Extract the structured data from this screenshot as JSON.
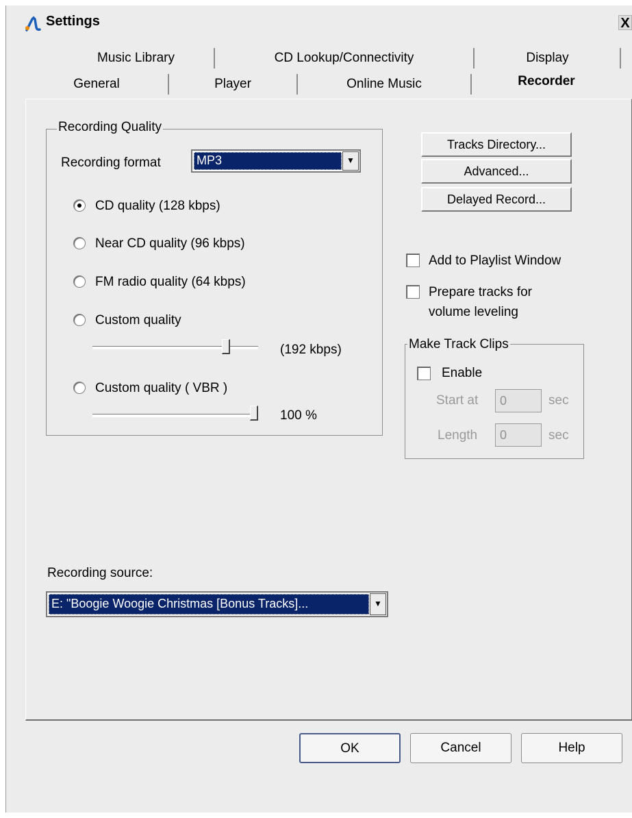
{
  "window": {
    "title": "Settings",
    "close_glyph": "X"
  },
  "tabs": {
    "row1": [
      "Music Library",
      "CD Lookup/Connectivity",
      "Display"
    ],
    "row2": [
      "General",
      "Player",
      "Online Music",
      "Recorder"
    ],
    "active": "Recorder"
  },
  "recording_quality": {
    "group_label": "Recording Quality",
    "format_label": "Recording format",
    "format_value": "MP3",
    "options": [
      "CD quality (128 kbps)",
      "Near CD quality (96 kbps)",
      "FM radio quality (64 kbps)",
      "Custom quality",
      "Custom quality ( VBR )"
    ],
    "selected_option_index": 0,
    "custom_slider_text": "(192 kbps)",
    "custom_slider_level": 0.82,
    "vbr_slider_text": "100 %",
    "vbr_slider_level": 1.0
  },
  "side_buttons": [
    "Tracks Directory...",
    "Advanced...",
    "Delayed Record..."
  ],
  "checkboxes": {
    "add_to_playlist": {
      "label": "Add to Playlist Window",
      "checked": false
    },
    "prepare_tracks": {
      "label_line1": "Prepare tracks for",
      "label_line2": "volume leveling",
      "checked": false
    }
  },
  "track_clips": {
    "group_label": "Make Track Clips",
    "enable_label": "Enable",
    "enable_checked": false,
    "start_label": "Start at",
    "start_value": "0",
    "length_label": "Length",
    "length_value": "0",
    "unit": "sec"
  },
  "recording_source": {
    "label": "Recording source:",
    "value": "E: \"Boogie Woogie Christmas [Bonus Tracks]..."
  },
  "footer": {
    "ok": "OK",
    "cancel": "Cancel",
    "help": "Help"
  },
  "colors": {
    "selection": "#0a246a",
    "window_bg": "#ececec"
  }
}
